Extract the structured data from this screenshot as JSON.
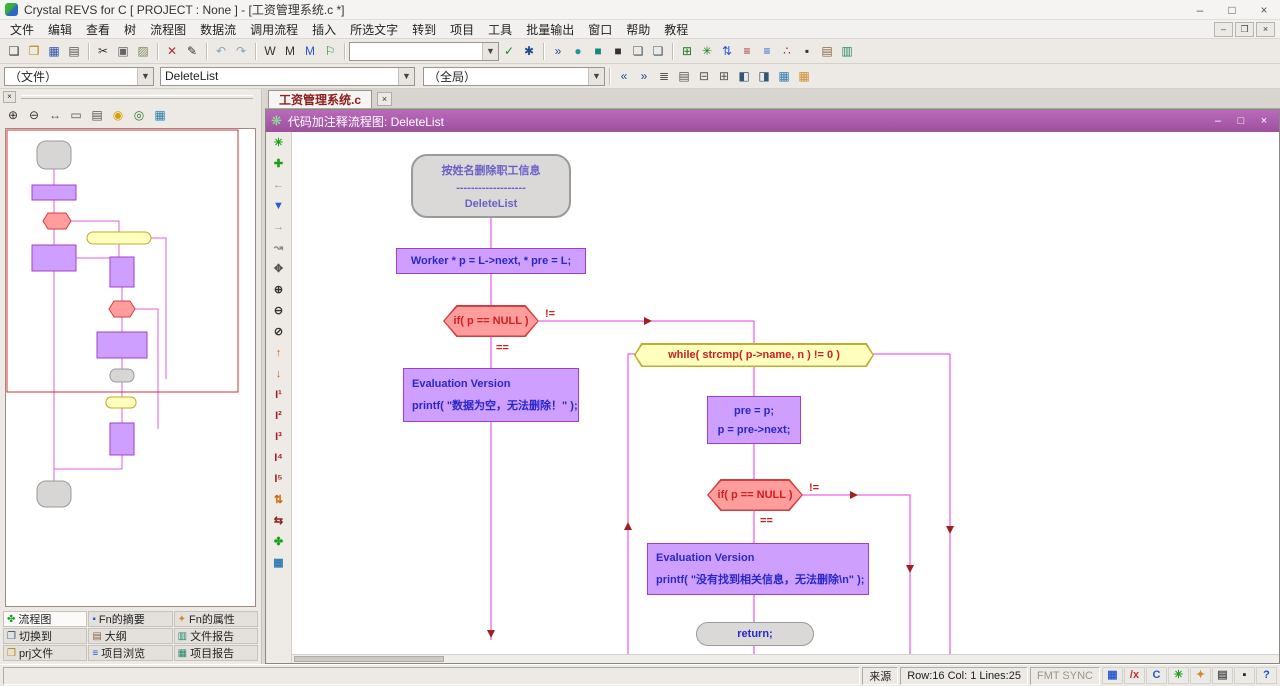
{
  "colors": {
    "fc_titlebar": "#9d509d",
    "connector": "#e838e8",
    "node_purple": "#cf9fff",
    "node_pink": "#ff9c9c",
    "node_yellow": "#ffffbe",
    "node_gray": "#dbd9d7",
    "accent_red": "#d02020"
  },
  "chrome": {
    "minimize": "–",
    "maximize": "□",
    "restore": "❐",
    "close": "×"
  },
  "titlebar": {
    "title": "Crystal REVS for C    [ PROJECT : None ] - [工资管理系统.c *]"
  },
  "menubar": {
    "items": [
      "文件",
      "编辑",
      "查看",
      "树",
      "流程图",
      "数据流",
      "调用流程",
      "插入",
      "所选文字",
      "转到",
      "项目",
      "工具",
      "批量输出",
      "窗口",
      "帮助",
      "教程"
    ]
  },
  "toolbar_main": {
    "file_group": [
      {
        "name": "new-file-icon",
        "glyph": "❑",
        "color": "#333333"
      },
      {
        "name": "open-folder-icon",
        "glyph": "❒",
        "color": "#b8860b"
      },
      {
        "name": "save-icon",
        "glyph": "▦",
        "color": "#2b4faa"
      },
      {
        "name": "print-icon",
        "glyph": "▤",
        "color": "#555555"
      }
    ],
    "clipboard_group": [
      {
        "name": "cut-icon",
        "glyph": "✂",
        "color": "#333333"
      },
      {
        "name": "copy-icon",
        "glyph": "▣",
        "color": "#666666"
      },
      {
        "name": "paste-icon",
        "glyph": "▨",
        "color": "#7a8a5a"
      }
    ],
    "edit_group": [
      {
        "name": "delete-icon",
        "glyph": "✕",
        "color": "#b03030"
      },
      {
        "name": "edit-icon",
        "glyph": "✎",
        "color": "#333333"
      }
    ],
    "undo_group": [
      {
        "name": "undo-icon",
        "glyph": "↶",
        "color": "#8aa0b8"
      },
      {
        "name": "redo-icon",
        "glyph": "↷",
        "color": "#8aa0b8"
      }
    ],
    "mark_group": [
      {
        "name": "watch-icon",
        "glyph": "W",
        "color": "#333333"
      },
      {
        "name": "mark-icon",
        "glyph": "M",
        "color": "#333333"
      },
      {
        "name": "mark-all-icon",
        "glyph": "M",
        "color": "#2a5ad0"
      },
      {
        "name": "flag-icon",
        "glyph": "⚐",
        "color": "#1a8a1a"
      }
    ],
    "search_value": "",
    "confirm_group": [
      {
        "name": "apply-search-icon",
        "glyph": "✓",
        "color": "#1a8a1a"
      },
      {
        "name": "find-icon",
        "glyph": "✱",
        "color": "#234a8c"
      }
    ],
    "view_group": [
      {
        "name": "expand-all-icon",
        "glyph": "»",
        "color": "#234a8c"
      },
      {
        "name": "ink-drop-icon",
        "glyph": "●",
        "color": "#1a9aa0"
      },
      {
        "name": "teal-block-icon",
        "glyph": "■",
        "color": "#0f8a80"
      },
      {
        "name": "dark-block-icon",
        "glyph": "■",
        "color": "#333333"
      },
      {
        "name": "window-pane-icon",
        "glyph": "❏",
        "color": "#445566"
      },
      {
        "name": "window-pane2-icon",
        "glyph": "❏",
        "color": "#445566"
      }
    ],
    "tree_group": [
      {
        "name": "tree-view-icon",
        "glyph": "⊞",
        "color": "#1a7a1a"
      },
      {
        "name": "flow-tree-icon",
        "glyph": "✳",
        "color": "#1a7a1a"
      },
      {
        "name": "sort-icon",
        "glyph": "⇅",
        "color": "#2a5ad0"
      },
      {
        "name": "detail-list-icon",
        "glyph": "≡",
        "color": "#a03030"
      },
      {
        "name": "detail-list2-icon",
        "glyph": "≡",
        "color": "#2a5ad0"
      },
      {
        "name": "dots-icon",
        "glyph": "∴",
        "color": "#a03030"
      },
      {
        "name": "block-icon",
        "glyph": "▪",
        "color": "#333333"
      },
      {
        "name": "doc-report-icon",
        "glyph": "▤",
        "color": "#886644"
      },
      {
        "name": "stats-icon",
        "glyph": "▥",
        "color": "#22886a"
      }
    ]
  },
  "toolbar_nav": {
    "file_combo": "（文件）",
    "symbol_combo": "DeleteList",
    "scope_combo": "（全局）",
    "nav_group": [
      {
        "name": "token-prev-icon",
        "glyph": "«",
        "color": "#234a8c"
      },
      {
        "name": "token-next-icon",
        "glyph": "»",
        "color": "#234a8c"
      },
      {
        "name": "line-view-icon",
        "glyph": "≣",
        "color": "#555555"
      },
      {
        "name": "block-view-icon",
        "glyph": "▤",
        "color": "#555555"
      },
      {
        "name": "collapse-icon",
        "glyph": "⊟",
        "color": "#555555"
      },
      {
        "name": "expand-icon",
        "glyph": "⊞",
        "color": "#555555"
      },
      {
        "name": "margin-left-icon",
        "glyph": "◧",
        "color": "#335577"
      },
      {
        "name": "margin-right-icon",
        "glyph": "◨",
        "color": "#335577"
      },
      {
        "name": "grid-zoom-icon",
        "glyph": "▦",
        "color": "#2a7ab0"
      },
      {
        "name": "table-icon",
        "glyph": "▦",
        "color": "#d08a2a"
      }
    ]
  },
  "left_panel": {
    "toolbar": [
      {
        "name": "zoom-in-icon",
        "glyph": "⊕",
        "color": "#333333"
      },
      {
        "name": "zoom-out-icon",
        "glyph": "⊖",
        "color": "#333333"
      },
      {
        "name": "fit-width-icon",
        "glyph": "↔",
        "color": "#555555"
      },
      {
        "name": "fit-page-icon",
        "glyph": "▭",
        "color": "#555555"
      },
      {
        "name": "pages-icon",
        "glyph": "▤",
        "color": "#555555"
      },
      {
        "name": "highlight-pair-icon",
        "glyph": "◉",
        "color": "#d8a200"
      },
      {
        "name": "target-icon",
        "glyph": "◎",
        "color": "#2a7a2a"
      },
      {
        "name": "map-icon",
        "glyph": "▦",
        "color": "#2a7ab0"
      }
    ],
    "tabs": [
      {
        "name": "tab-flowchart",
        "glyph": "✤",
        "color": "#18a018",
        "label": "流程图"
      },
      {
        "name": "tab-fn-summary",
        "glyph": "▪",
        "color": "#2a5ad0",
        "label": "Fn的摘要"
      },
      {
        "name": "tab-fn-properties",
        "glyph": "✦",
        "color": "#d08a2a",
        "label": "Fn的属性"
      },
      {
        "name": "tab-switch-to",
        "glyph": "❐",
        "color": "#335577",
        "label": "切换到"
      },
      {
        "name": "tab-outline",
        "glyph": "▤",
        "color": "#886644",
        "label": "大纲"
      },
      {
        "name": "tab-file-report",
        "glyph": "▥",
        "color": "#22886a",
        "label": "文件报告"
      },
      {
        "name": "tab-prj-files",
        "glyph": "❒",
        "color": "#b8860b",
        "label": "prj文件"
      },
      {
        "name": "tab-project-browse",
        "glyph": "≡",
        "color": "#2a5ad0",
        "label": "项目浏览"
      },
      {
        "name": "tab-project-report",
        "glyph": "▦",
        "color": "#22886a",
        "label": "项目报告"
      }
    ]
  },
  "doc": {
    "tab_label": "工资管理系统.c"
  },
  "flowchart": {
    "window_title": "代码加注释流程图:  DeleteList",
    "vstrip": [
      {
        "name": "align-icon",
        "glyph": "✳",
        "color": "#18a018"
      },
      {
        "name": "center-node-icon",
        "glyph": "✚",
        "color": "#18a018"
      },
      {
        "name": "back-icon",
        "glyph": "←",
        "color": "#9a9a9a"
      },
      {
        "name": "down-chevron-icon",
        "glyph": "▼",
        "color": "#2a5ad0"
      },
      {
        "name": "forward-icon",
        "glyph": "→",
        "color": "#9a9a9a"
      },
      {
        "name": "jump-icon",
        "glyph": "↝",
        "color": "#888888"
      },
      {
        "name": "pan-icon",
        "glyph": "✥",
        "color": "#555555"
      },
      {
        "name": "zoom-in-canvas-icon",
        "glyph": "⊕",
        "color": "#333333"
      },
      {
        "name": "zoom-out-canvas-icon",
        "glyph": "⊖",
        "color": "#333333"
      },
      {
        "name": "zoom-select-icon",
        "glyph": "⊘",
        "color": "#333333"
      },
      {
        "name": "scroll-up-icon",
        "glyph": "↑",
        "color": "#d06000"
      },
      {
        "name": "scroll-down-icon",
        "glyph": "↓",
        "color": "#d06000"
      },
      {
        "name": "level1-icon",
        "glyph": "I¹",
        "color": "#a02020"
      },
      {
        "name": "level2-icon",
        "glyph": "I²",
        "color": "#a02020"
      },
      {
        "name": "level3-icon",
        "glyph": "I³",
        "color": "#a02020"
      },
      {
        "name": "level4-icon",
        "glyph": "I⁴",
        "color": "#a02020"
      },
      {
        "name": "level5-icon",
        "glyph": "I⁵",
        "color": "#a02020"
      },
      {
        "name": "swap-vert-icon",
        "glyph": "⇅",
        "color": "#d06000"
      },
      {
        "name": "swap-horiz-icon",
        "glyph": "⇆",
        "color": "#8a2020"
      },
      {
        "name": "relayout-icon",
        "glyph": "✤",
        "color": "#18a018"
      },
      {
        "name": "export-grid-icon",
        "glyph": "▦",
        "color": "#2a7ab0"
      }
    ],
    "start": {
      "line1": "按姓名删除职工信息",
      "line2": "-------------------",
      "line3": "DeleteList"
    },
    "decl": "Worker * p = L->next, * pre = L;",
    "if1": "if( p == NULL )",
    "label_eq": "==",
    "label_neq": "!=",
    "eval1_line1": "Evaluation Version",
    "eval1_line2": "printf( \"数据为空，无法删除！\" );",
    "while1": "while( strcmp( p->name, n ) != 0 )",
    "body_line1": "pre = p;",
    "body_line2": "p = pre->next;",
    "if2": "if( p == NULL )",
    "eval2_line1": "Evaluation Version",
    "eval2_line2": "printf( \"没有找到相关信息，无法删除\\n\" );",
    "return_text": "return;"
  },
  "statusbar": {
    "source": "来源",
    "position": "Row:16 Col: 1 Lines:25",
    "fmt": "FMT SYNC",
    "icons": [
      {
        "name": "grid-status-icon",
        "glyph": "▦",
        "color": "#2a5ad0"
      },
      {
        "name": "regex-icon",
        "glyph": "/x",
        "color": "#c03030"
      },
      {
        "name": "c-lang-icon",
        "glyph": "C",
        "color": "#2a5ad0"
      },
      {
        "name": "tokens-icon",
        "glyph": "✳",
        "color": "#18a018"
      },
      {
        "name": "build-icon",
        "glyph": "✦",
        "color": "#d08a2a"
      },
      {
        "name": "panel-icon",
        "glyph": "▤",
        "color": "#555555"
      },
      {
        "name": "dark-icon",
        "glyph": "▪",
        "color": "#222222"
      },
      {
        "name": "help-icon",
        "glyph": "?",
        "color": "#1a50c0"
      }
    ]
  }
}
